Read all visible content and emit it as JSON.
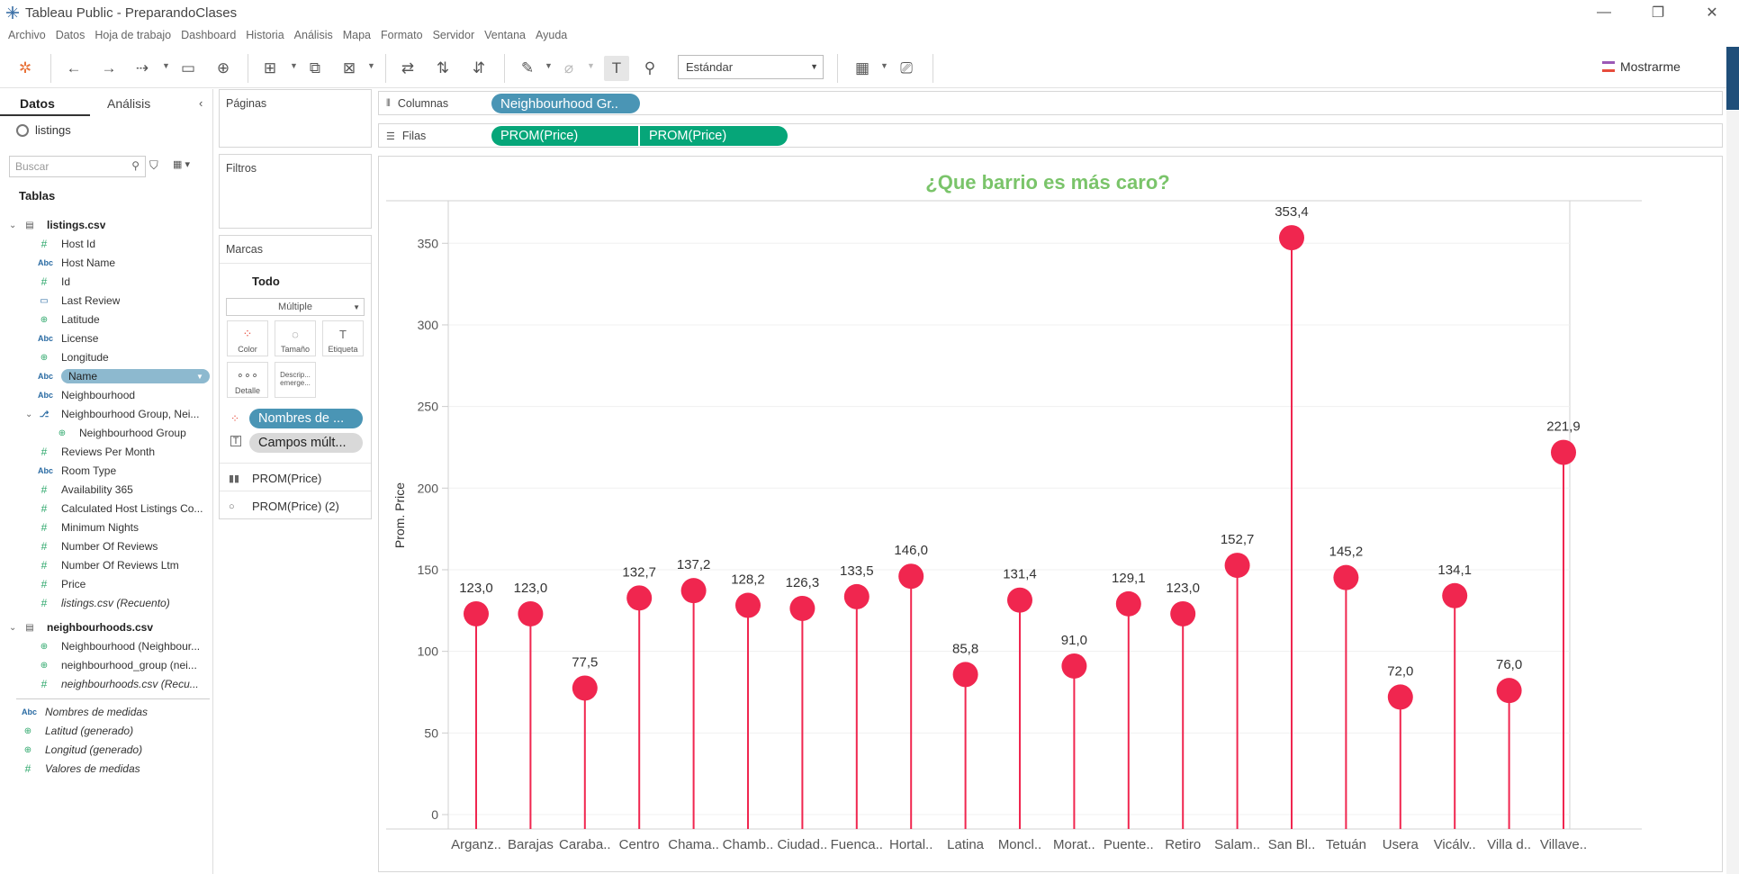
{
  "window": {
    "title": "Tableau Public - PreparandoClases",
    "min": "—",
    "restore": "❐",
    "close": "✕"
  },
  "menu": [
    "Archivo",
    "Datos",
    "Hoja de trabajo",
    "Dashboard",
    "Historia",
    "Análisis",
    "Mapa",
    "Formato",
    "Servidor",
    "Ventana",
    "Ayuda"
  ],
  "toolbar": {
    "fit_select": "Estándar",
    "show_me": "Mostrarme"
  },
  "datapane": {
    "tab_data": "Datos",
    "tab_analysis": "Análisis",
    "datasource": "listings",
    "search_placeholder": "Buscar",
    "tables_header": "Tablas",
    "fields": [
      {
        "label": "listings.csv",
        "icon": "table-icon",
        "kind": "table"
      },
      {
        "label": "Host Id",
        "icon": "number-icon",
        "kind": "num"
      },
      {
        "label": "Host Name",
        "icon": "abc-icon",
        "kind": "abc"
      },
      {
        "label": "Id",
        "icon": "number-icon",
        "kind": "num"
      },
      {
        "label": "Last Review",
        "icon": "calendar-icon",
        "kind": "date"
      },
      {
        "label": "Latitude",
        "icon": "globe-icon",
        "kind": "geo"
      },
      {
        "label": "License",
        "icon": "abc-icon",
        "kind": "abc"
      },
      {
        "label": "Longitude",
        "icon": "globe-icon",
        "kind": "geo"
      },
      {
        "label": "Name",
        "icon": "abc-icon",
        "kind": "abc",
        "selected": true
      },
      {
        "label": "Neighbourhood",
        "icon": "abc-icon",
        "kind": "abc"
      },
      {
        "label": "Neighbourhood Group, Nei...",
        "icon": "hierarchy-icon",
        "kind": "hier"
      },
      {
        "label": "Neighbourhood Group",
        "icon": "globe-icon",
        "kind": "geo",
        "indent": true
      },
      {
        "label": "Reviews Per Month",
        "icon": "number-icon",
        "kind": "num"
      },
      {
        "label": "Room Type",
        "icon": "abc-icon",
        "kind": "abc"
      },
      {
        "label": "Availability 365",
        "icon": "number-icon",
        "kind": "num"
      },
      {
        "label": "Calculated Host Listings Co...",
        "icon": "number-icon",
        "kind": "num"
      },
      {
        "label": "Minimum Nights",
        "icon": "number-icon",
        "kind": "num"
      },
      {
        "label": "Number Of Reviews",
        "icon": "number-icon",
        "kind": "num"
      },
      {
        "label": "Number Of Reviews Ltm",
        "icon": "number-icon",
        "kind": "num"
      },
      {
        "label": "Price",
        "icon": "number-icon",
        "kind": "num"
      },
      {
        "label": "listings.csv (Recuento)",
        "icon": "number-icon",
        "kind": "num",
        "italic": true
      },
      {
        "label": "neighbourhoods.csv",
        "icon": "table-icon",
        "kind": "table"
      },
      {
        "label": "Neighbourhood (Neighbour...",
        "icon": "globe-icon",
        "kind": "geo"
      },
      {
        "label": "neighbourhood_group (nei...",
        "icon": "globe-icon",
        "kind": "geo"
      },
      {
        "label": "neighbourhoods.csv (Recu...",
        "icon": "number-icon",
        "kind": "num",
        "italic": true
      },
      {
        "label": "Nombres de medidas",
        "icon": "abc-icon",
        "kind": "abc",
        "italic": true,
        "outer": true
      },
      {
        "label": "Latitud (generado)",
        "icon": "globe-icon",
        "kind": "geo",
        "italic": true,
        "outer": true
      },
      {
        "label": "Longitud (generado)",
        "icon": "globe-icon",
        "kind": "geo",
        "italic": true,
        "outer": true
      },
      {
        "label": "Valores de medidas",
        "icon": "number-icon",
        "kind": "num",
        "italic": true,
        "outer": true
      }
    ]
  },
  "cards": {
    "pages": "Páginas",
    "filters": "Filtros",
    "marks": "Marcas",
    "marks_all": "Todo",
    "mark_type": "Múltiple",
    "buttons": {
      "color": "Color",
      "size": "Tamaño",
      "label": "Etiqueta",
      "detail": "Detalle",
      "tooltip": "Descrip... emerge..."
    },
    "pill_color": "Nombres de ...",
    "pill_label": "Campos múlt...",
    "measure1": "PROM(Price)",
    "measure2": "PROM(Price) (2)"
  },
  "shelves": {
    "columns_label": "Columnas",
    "rows_label": "Filas",
    "columns_pill": "Neighbourhood Gr..",
    "rows_pill_1": "PROM(Price)",
    "rows_pill_2": "PROM(Price)"
  },
  "colors": {
    "lollipop": "#f0264f",
    "title": "#7ac46a",
    "pill_blue": "#4a95b5",
    "pill_green": "#06a679"
  },
  "chart_data": {
    "type": "lollipop",
    "title": "¿Que barrio es más caro?",
    "ylabel": "Prom. Price",
    "ylim": [
      0,
      370
    ],
    "yticks": [
      0,
      50,
      100,
      150,
      200,
      250,
      300,
      350
    ],
    "categories": [
      "Arganz..",
      "Barajas",
      "Caraba..",
      "Centro",
      "Chama..",
      "Chamb..",
      "Ciudad..",
      "Fuenca..",
      "Hortal..",
      "Latina",
      "Moncl..",
      "Morat..",
      "Puente..",
      "Retiro",
      "Salam..",
      "San Bl..",
      "Tetuán",
      "Usera",
      "Vicálv..",
      "Villa d..",
      "Villave.."
    ],
    "values": [
      123.0,
      123.0,
      77.5,
      132.7,
      137.2,
      128.2,
      126.3,
      133.5,
      146.0,
      85.8,
      131.4,
      91.0,
      129.1,
      123.0,
      152.7,
      353.4,
      145.2,
      72.0,
      134.1,
      76.0,
      221.9
    ],
    "labels": [
      "123,0",
      "123,0",
      "77,5",
      "132,7",
      "137,2",
      "128,2",
      "126,3",
      "133,5",
      "146,0",
      "85,8",
      "131,4",
      "91,0",
      "129,1",
      "123,0",
      "152,7",
      "353,4",
      "145,2",
      "72,0",
      "134,1",
      "76,0",
      "221,9"
    ],
    "grid": true
  }
}
